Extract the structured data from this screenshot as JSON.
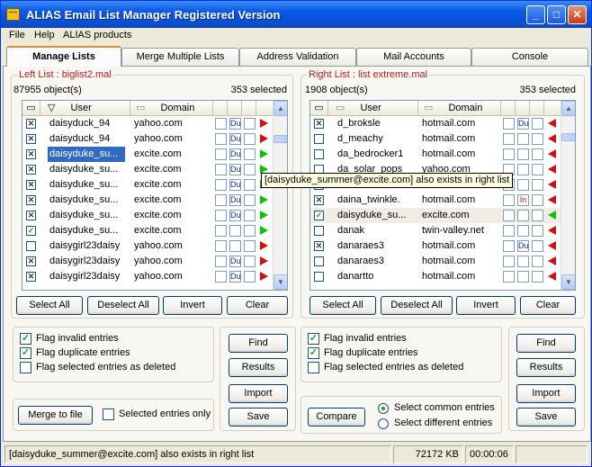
{
  "window": {
    "title": "ALIAS Email List Manager Registered Version",
    "controls": {
      "minimize": "_",
      "maximize": "□",
      "close": "✕"
    }
  },
  "menu": [
    "File",
    "Help",
    "ALIAS products"
  ],
  "tabs": [
    "Manage Lists",
    "Merge Multiple Lists",
    "Address Validation",
    "Mail Accounts",
    "Console"
  ],
  "active_tab": "Manage Lists",
  "left": {
    "title": "Left List : biglist2.mal",
    "object_count": "87955 object(s)",
    "selected_count": "353 selected",
    "columns": {
      "sort": "▽",
      "user": "User",
      "domain": "Domain"
    },
    "rows": [
      {
        "check": "x",
        "user": "daisyduck_94",
        "domain": "yahoo.com",
        "mark": "Du",
        "arrow": "red",
        "selected": false
      },
      {
        "check": "x",
        "user": "daisyduck_94",
        "domain": "yahoo.com",
        "mark": "Du",
        "arrow": "red",
        "selected": false
      },
      {
        "check": "x",
        "user": "daisyduke_su...",
        "domain": "excite.com",
        "mark": "Du",
        "arrow": "green",
        "selected": true
      },
      {
        "check": "x",
        "user": "daisyduke_su...",
        "domain": "excite.com",
        "mark": "Du",
        "arrow": "green",
        "selected": false
      },
      {
        "check": "x",
        "user": "daisyduke_su...",
        "domain": "excite.com",
        "mark": "Du",
        "arrow": "green",
        "selected": false
      },
      {
        "check": "x",
        "user": "daisyduke_su...",
        "domain": "excite.com",
        "mark": "Du",
        "arrow": "green",
        "selected": false
      },
      {
        "check": "x",
        "user": "daisyduke_su...",
        "domain": "excite.com",
        "mark": "Du",
        "arrow": "green",
        "selected": false
      },
      {
        "check": "v",
        "user": "daisyduke_su...",
        "domain": "excite.com",
        "mark": "",
        "arrow": "green",
        "selected": false
      },
      {
        "check": "",
        "user": "daisygirl23daisy",
        "domain": "yahoo.com",
        "mark": "",
        "arrow": "red",
        "selected": false
      },
      {
        "check": "x",
        "user": "daisygirl23daisy",
        "domain": "yahoo.com",
        "mark": "Du",
        "arrow": "red",
        "selected": false
      },
      {
        "check": "x",
        "user": "daisygirl23daisy",
        "domain": "yahoo.com",
        "mark": "Du",
        "arrow": "red",
        "selected": false
      }
    ],
    "buttons": {
      "select_all": "Select All",
      "deselect_all": "Deselect All",
      "invert": "Invert",
      "clear": "Clear"
    },
    "flags": {
      "invalid": {
        "label": "Flag invalid entries",
        "checked": true
      },
      "duplicate": {
        "label": "Flag duplicate entries",
        "checked": true
      },
      "deleted": {
        "label": "Flag selected entries as deleted",
        "checked": false
      }
    },
    "actions": {
      "find": "Find",
      "results": "Results",
      "import": "Import",
      "save": "Save"
    },
    "merge": {
      "button": "Merge to file",
      "selected_only": "Selected entries only"
    }
  },
  "right": {
    "title": "Right List : list extreme.mal",
    "object_count": "1908 object(s)",
    "selected_count": "353 selected",
    "columns": {
      "user": "User",
      "domain": "Domain"
    },
    "rows": [
      {
        "check": "x",
        "user": "d_broksle",
        "domain": "hotmail.com",
        "mark": "Du",
        "arrow": "red",
        "hl": false
      },
      {
        "check": "",
        "user": "d_meachy",
        "domain": "hotmail.com",
        "mark": "",
        "arrow": "red",
        "hl": false
      },
      {
        "check": "",
        "user": "da_bedrocker1",
        "domain": "hotmail.com",
        "mark": "",
        "arrow": "red",
        "hl": false
      },
      {
        "check": "",
        "user": "da_solar_pops",
        "domain": "yahoo.com",
        "mark": "",
        "arrow": "red",
        "hl": false
      },
      {
        "check": "",
        "user": "",
        "domain": "",
        "mark": "",
        "arrow": "red",
        "hl": false
      },
      {
        "check": "x",
        "user": "daina_twinkle.",
        "domain": "hotmail.com",
        "mark": "In",
        "arrow": "red",
        "hl": false
      },
      {
        "check": "v",
        "user": "daisyduke_su...",
        "domain": "excite.com",
        "mark": "",
        "arrow": "green",
        "hl": true
      },
      {
        "check": "",
        "user": "danak",
        "domain": "twin-valley.net",
        "mark": "",
        "arrow": "red",
        "hl": false
      },
      {
        "check": "x",
        "user": "danaraes3",
        "domain": "hotmail.com",
        "mark": "Du",
        "arrow": "red",
        "hl": false
      },
      {
        "check": "",
        "user": "danaraes3",
        "domain": "hotmail.com",
        "mark": "",
        "arrow": "red",
        "hl": false
      },
      {
        "check": "",
        "user": "danartto",
        "domain": "hotmail.com",
        "mark": "",
        "arrow": "red",
        "hl": false
      }
    ],
    "buttons": {
      "select_all": "Select All",
      "deselect_all": "Deselect All",
      "invert": "Invert",
      "clear": "Clear"
    },
    "flags": {
      "invalid": {
        "label": "Flag invalid entries",
        "checked": true
      },
      "duplicate": {
        "label": "Flag duplicate entries",
        "checked": true
      },
      "deleted": {
        "label": "Flag selected entries as deleted",
        "checked": false
      }
    },
    "actions": {
      "find": "Find",
      "results": "Results",
      "import": "Import",
      "save": "Save"
    },
    "compare": {
      "button": "Compare",
      "common": "Select common entries",
      "different": "Select different entries",
      "selected": "common"
    }
  },
  "tooltip": "[daisyduke_summer@excite.com] also exists in right list",
  "status": {
    "message": "[daisyduke_summer@excite.com] also exists in right list",
    "memory": "72172 KB",
    "time": "00:00:06"
  },
  "colors": {
    "accent": "#316ac5",
    "title_red": "#b02020",
    "arrow_red": "#d01010",
    "arrow_green": "#10c010"
  }
}
